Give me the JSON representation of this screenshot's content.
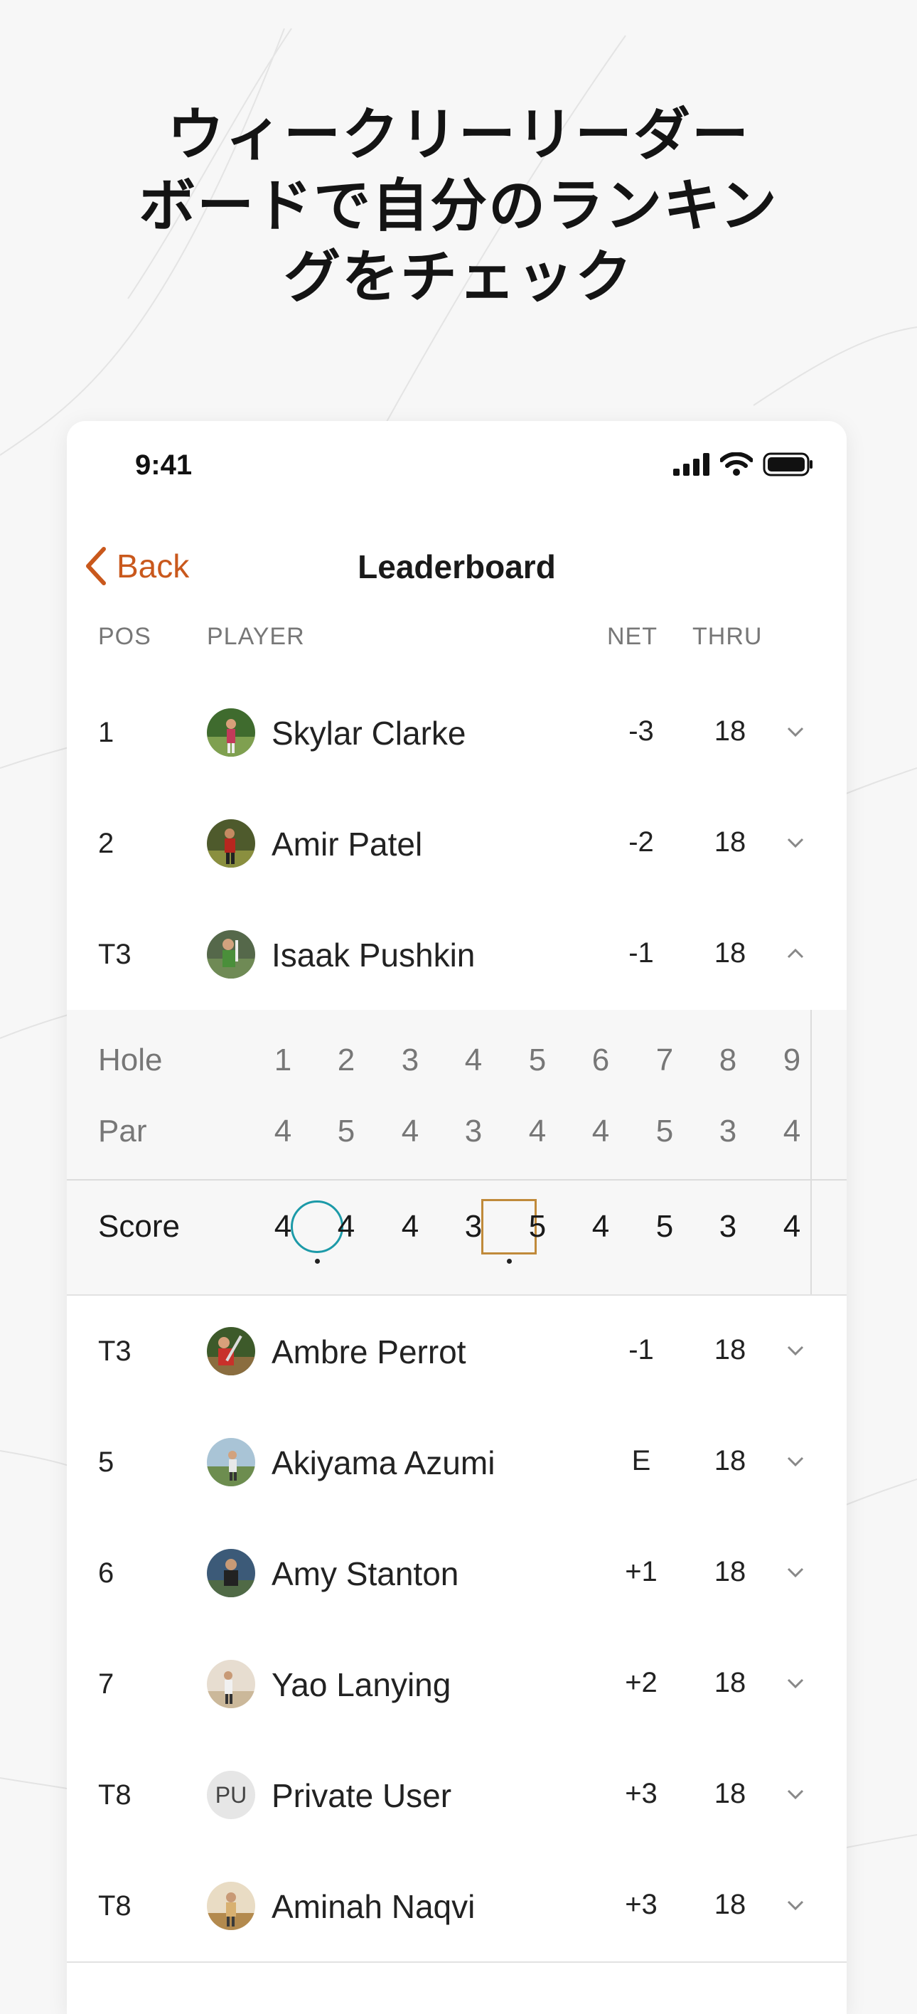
{
  "headline": {
    "line1": "ウィークリーリーダー",
    "line2": "ボードで自分のランキン",
    "line3": "グをチェック"
  },
  "status_bar": {
    "time": "9:41",
    "icons": [
      "signal-icon",
      "wifi-icon",
      "battery-icon"
    ]
  },
  "nav": {
    "back_label": "Back",
    "title": "Leaderboard"
  },
  "columns": {
    "pos": "POS",
    "player": "PLAYER",
    "net": "NET",
    "thru": "THRU"
  },
  "accent_color": "#c9581c",
  "players": [
    {
      "pos": "1",
      "name": "Skylar Clarke",
      "net": "-3",
      "thru": "18",
      "expanded": false
    },
    {
      "pos": "2",
      "name": "Amir Patel",
      "net": "-2",
      "thru": "18",
      "expanded": false
    },
    {
      "pos": "T3",
      "name": "Isaak Pushkin",
      "net": "-1",
      "thru": "18",
      "expanded": true
    },
    {
      "pos": "T3",
      "name": "Ambre Perrot",
      "net": "-1",
      "thru": "18",
      "expanded": false
    },
    {
      "pos": "5",
      "name": "Akiyama Azumi",
      "net": "E",
      "thru": "18",
      "expanded": false
    },
    {
      "pos": "6",
      "name": "Amy Stanton",
      "net": "+1",
      "thru": "18",
      "expanded": false
    },
    {
      "pos": "7",
      "name": "Yao Lanying",
      "net": "+2",
      "thru": "18",
      "expanded": false
    },
    {
      "pos": "T8",
      "name": "Private User",
      "net": "+3",
      "thru": "18",
      "expanded": false,
      "initials": "PU"
    },
    {
      "pos": "T8",
      "name": "Aminah Naqvi",
      "net": "+3",
      "thru": "18",
      "expanded": false
    }
  ],
  "scorecard": {
    "hole_label": "Hole",
    "par_label": "Par",
    "score_label": "Score",
    "holes": [
      "1",
      "2",
      "3",
      "4",
      "5",
      "6",
      "7",
      "8",
      "9"
    ],
    "par": [
      "4",
      "5",
      "4",
      "3",
      "4",
      "4",
      "5",
      "3",
      "4"
    ],
    "score": [
      "4",
      "4",
      "4",
      "3",
      "5",
      "4",
      "5",
      "3",
      "4"
    ],
    "birdie_marker_color": "#1c9aa8",
    "bogey_marker_color": "#c08a3a"
  }
}
